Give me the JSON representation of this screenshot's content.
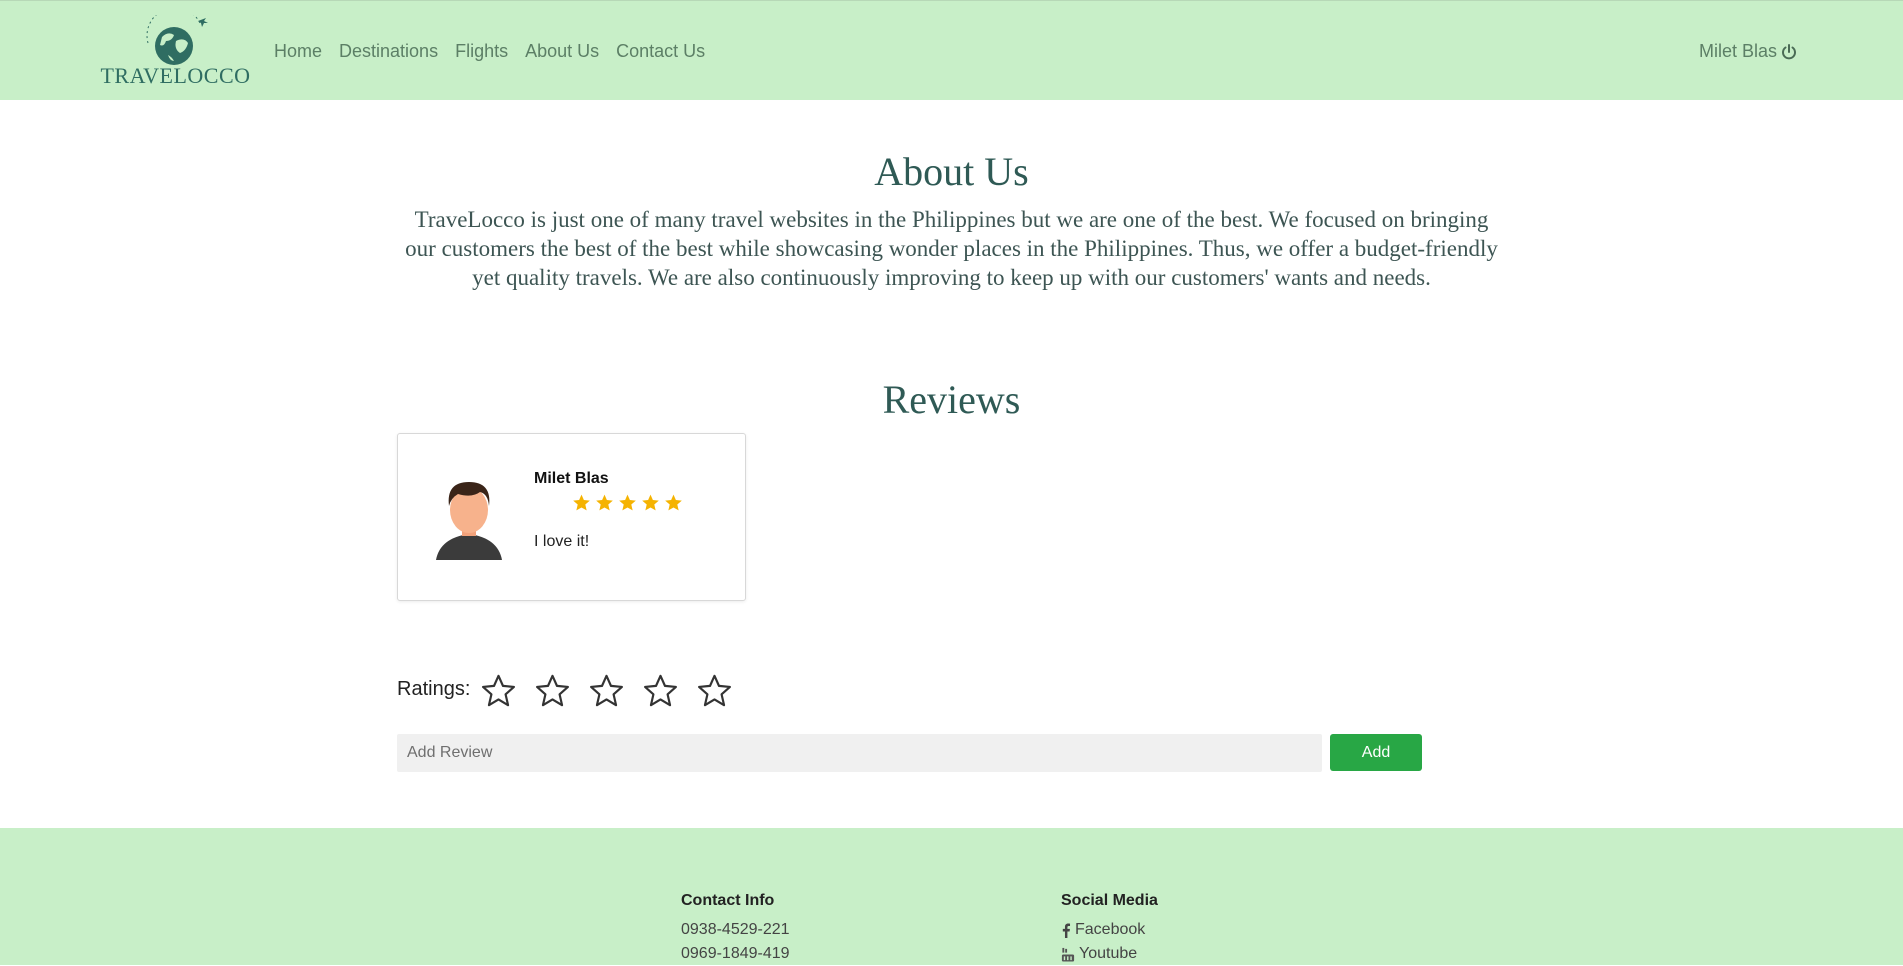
{
  "header": {
    "brand": "TRAVELOCCO",
    "nav": [
      "Home",
      "Destinations",
      "Flights",
      "About Us",
      "Contact Us"
    ],
    "user_name": "Milet Blas"
  },
  "about": {
    "title": "About Us",
    "text": "TraveLocco is just one of many travel websites in the Philippines but we are one of the best. We focused on bringing our customers the best of the best while showcasing wonder places in the Philippines. Thus, we offer a budget-friendly yet quality travels. We are also continuously improving to keep up with our customers' wants and needs."
  },
  "reviews": {
    "title": "Reviews",
    "items": [
      {
        "name": "Milet Blas",
        "rating": 5,
        "text": "I love it!"
      }
    ]
  },
  "rating_form": {
    "label": "Ratings:",
    "max_stars": 5,
    "selected": 0,
    "input_placeholder": "Add Review",
    "input_value": "",
    "add_label": "Add"
  },
  "footer": {
    "contact_heading": "Contact Info",
    "phones": [
      "0938-4529-221",
      "0969-1849-419"
    ],
    "social_heading": "Social Media",
    "social": [
      {
        "label": "Facebook",
        "icon": "facebook-icon"
      },
      {
        "label": "Youtube",
        "icon": "youtube-icon"
      }
    ]
  },
  "colors": {
    "header_bg": "#c8efc8",
    "footer_bg": "#c8efc8",
    "brand": "#2f6d62",
    "star_filled": "#f5b301",
    "add_button": "#28a745"
  }
}
